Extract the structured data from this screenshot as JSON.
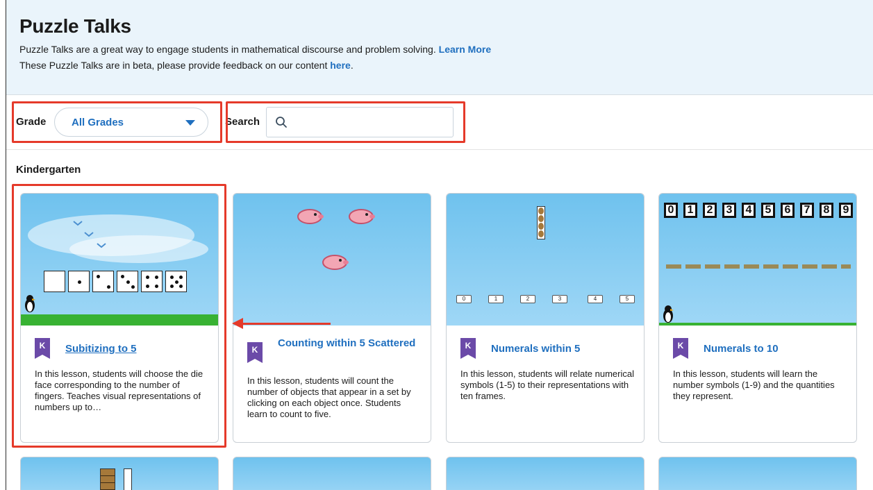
{
  "header": {
    "title": "Puzzle Talks",
    "line1_text": "Puzzle Talks are a great way to engage students in mathematical discourse and problem solving.",
    "line1_link": "Learn More",
    "line2_text": "These Puzzle Talks are in beta, please provide feedback on our content",
    "line2_link": "here",
    "line2_end": "."
  },
  "filters": {
    "grade_label": "Grade",
    "grade_value": "All Grades",
    "search_label": "Search",
    "search_value": "",
    "search_placeholder": ""
  },
  "section": {
    "title": "Kindergarten"
  },
  "cards": [
    {
      "badge": "K",
      "title": "Subitizing to 5",
      "description": "In this lesson, students will choose the die face corresponding to the number of fingers. Teaches visual representations of numbers up to…"
    },
    {
      "badge": "K",
      "title": "Counting within 5 Scattered",
      "description": "In this lesson, students will count the number of objects that appear in a set by clicking on each object once. Students learn to count to five."
    },
    {
      "badge": "K",
      "title": "Numerals within 5",
      "description": "In this lesson, students will relate numerical symbols (1-5) to their representations with ten frames."
    },
    {
      "badge": "K",
      "title": "Numerals to 10",
      "description": "In this lesson, students will learn the number symbols (1-9) and the quantities they represent."
    }
  ],
  "card3_numbers": [
    "0",
    "1",
    "2",
    "3",
    "4",
    "5"
  ],
  "card4_digits": [
    "0",
    "1",
    "2",
    "3",
    "4",
    "5",
    "6",
    "7",
    "8",
    "9"
  ],
  "colors": {
    "link": "#1f6fbf",
    "badge": "#6b4aa8",
    "highlight": "#e53a2a",
    "header_bg": "#eaf4fb",
    "sky": "#6fc2ee",
    "grass": "#38b233"
  },
  "icons": {
    "caret": "caret-down-icon",
    "search": "search-icon",
    "penguin": "penguin-icon",
    "pig": "pig-icon"
  }
}
